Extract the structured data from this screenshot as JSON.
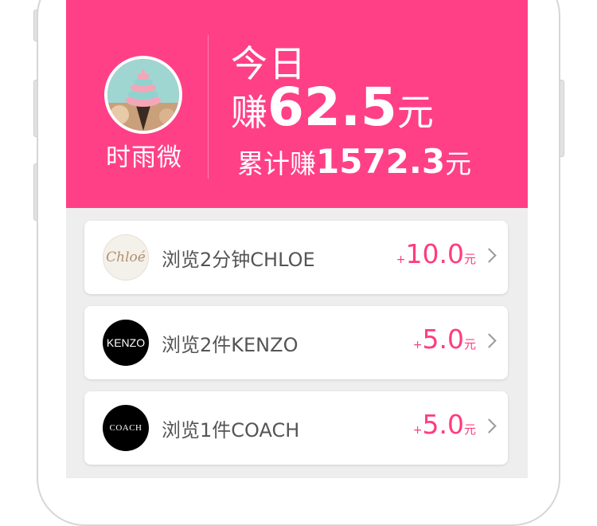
{
  "header": {
    "username": "时雨微",
    "today_label": "今日",
    "today_prefix": "赚",
    "today_amount": "62.5",
    "today_unit": "元",
    "total_prefix": "累计赚",
    "total_amount": "1572.3",
    "total_unit": "元",
    "bg_color": "#ff4086"
  },
  "tasks": [
    {
      "brand": "Chloé",
      "label": "浏览2分钟CHLOE",
      "plus": "+",
      "reward": "10.0",
      "unit": "元",
      "logo_icon": "chloe-logo-icon"
    },
    {
      "brand": "KENZO",
      "label": "浏览2件KENZO",
      "plus": "+",
      "reward": "5.0",
      "unit": "元",
      "logo_icon": "kenzo-logo-icon"
    },
    {
      "brand": "COACH",
      "label": "浏览1件COACH",
      "plus": "+",
      "reward": "5.0",
      "unit": "元",
      "logo_icon": "coach-logo-icon"
    }
  ],
  "colors": {
    "accent": "#ff3c7f",
    "card_bg": "#ffffff",
    "page_bg": "#eeeeee"
  }
}
